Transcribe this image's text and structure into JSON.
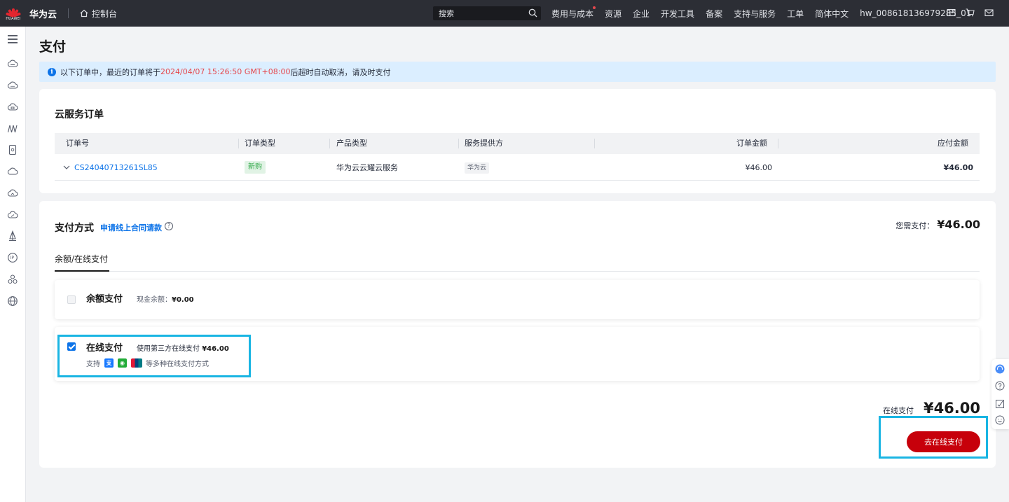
{
  "topbar": {
    "brand": "华为云",
    "logo_text": "HUAWEI",
    "console_label": "控制台",
    "search_placeholder": "搜索",
    "nav": [
      "费用与成本",
      "资源",
      "企业",
      "开发工具",
      "备案",
      "支持与服务",
      "工单",
      "简体中文",
      "hw_008618136979285_01"
    ],
    "icons": [
      "message-icon",
      "cart-icon",
      "mail-icon"
    ]
  },
  "page": {
    "title": "支付",
    "notice": {
      "prefix": "以下订单中，最近的订单将于",
      "deadline": "2024/04/07 15:26:50 GMT+08:00",
      "suffix": "后超时自动取消，请及时支付"
    }
  },
  "order_card": {
    "title": "云服务订单",
    "columns": [
      "订单号",
      "订单类型",
      "产品类型",
      "服务提供方",
      "订单金额",
      "应付金额"
    ],
    "rows": [
      {
        "order_no": "CS24040713261SL85",
        "type": "新购",
        "product": "华为云云耀云服务",
        "provider": "华为云",
        "amount": "¥46.00",
        "payable": "¥46.00"
      }
    ]
  },
  "payment": {
    "title": "支付方式",
    "contract_link": "申请线上合同请款",
    "need_pay_label": "您需支付：",
    "need_pay_value": "¥46.00",
    "tab": "余额/在线支付",
    "balance": {
      "name": "余额支付",
      "label": "现金余额：",
      "value": "¥0.00",
      "checked": false
    },
    "online": {
      "name": "在线支付",
      "desc": "使用第三方在线支付",
      "value": "¥46.00",
      "support_prefix": "支持",
      "support_suffix": "等多种在线支付方式",
      "checked": true
    },
    "total_label": "在线支付",
    "total_value": "¥46.00",
    "button": "去在线支付"
  },
  "colors": {
    "accent": "#0c73e8",
    "primary_button": "#c7000b",
    "highlight_box": "#19b5e3",
    "topbar": "#2c2e35"
  }
}
